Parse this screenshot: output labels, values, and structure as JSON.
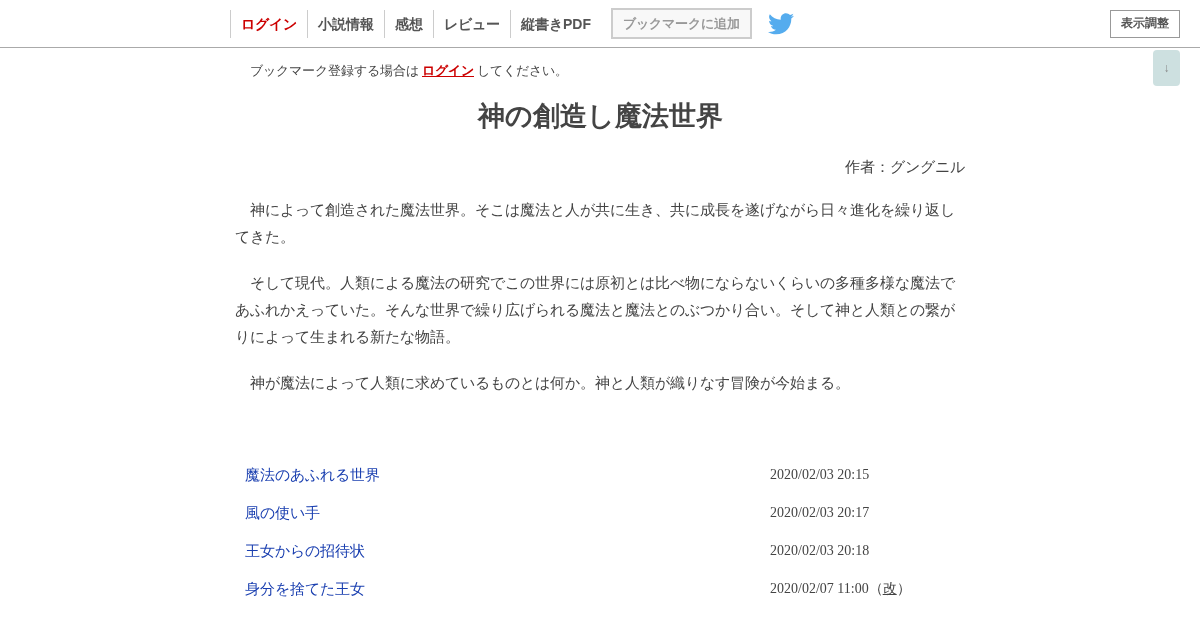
{
  "nav": {
    "items": [
      {
        "label": "ログイン",
        "kind": "login"
      },
      {
        "label": "小説情報",
        "kind": "link"
      },
      {
        "label": "感想",
        "kind": "link"
      },
      {
        "label": "レビュー",
        "kind": "link"
      },
      {
        "label": "縦書きPDF",
        "kind": "link"
      }
    ],
    "bookmark_button": {
      "label": "ブックマークに追加",
      "disabled": true
    },
    "display_button": "表示調整",
    "scroll_button": "↓"
  },
  "notice": {
    "before": "ブックマーク登録する場合は",
    "link": "ログイン",
    "after": "してください。"
  },
  "title": "神の創造し魔法世界",
  "author": "作者：グングニル",
  "synopsis": [
    "　神によって創造された魔法世界。そこは魔法と人が共に生き、共に成長を遂げながら日々進化を繰り返してきた。",
    "　そして現代。人類による魔法の研究でこの世界には原初とは比べ物にならないくらいの多種多様な魔法であふれかえっていた。そんな世界で繰り広げられる魔法と魔法とのぶつかり合い。そして神と人類との繋がりによって生まれる新たな物語。",
    "　神が魔法によって人類に求めているものとは何か。神と人類が織りなす冒険が今始まる。"
  ],
  "chapters": [
    {
      "title": "魔法のあふれる世界",
      "date": "2020/02/03 20:15"
    },
    {
      "title": "風の使い手",
      "date": "2020/02/03 20:17"
    },
    {
      "title": "王女からの招待状",
      "date": "2020/02/03 20:18"
    },
    {
      "title": "身分を捨てた王女",
      "date": "2020/02/07 11:00",
      "revision": {
        "open": "（",
        "link": "改",
        "close": "）"
      }
    }
  ]
}
